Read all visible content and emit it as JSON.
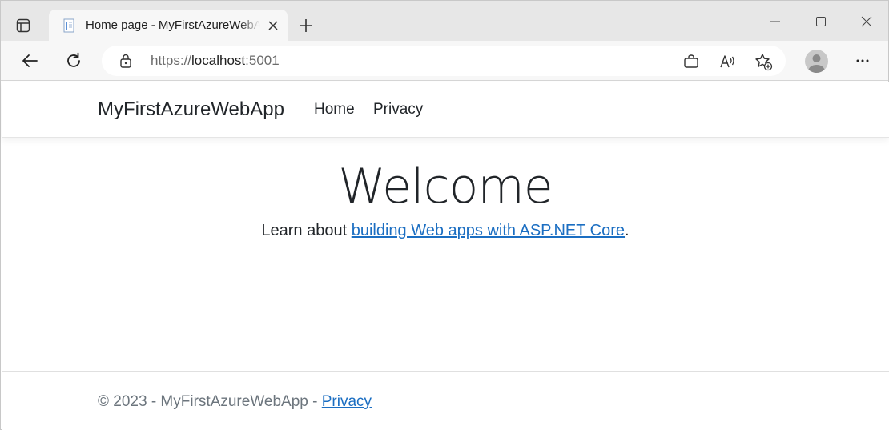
{
  "browser": {
    "tab": {
      "title": "Home page - MyFirstAzureWebApp"
    },
    "address": {
      "scheme": "https://",
      "host": "localhost",
      "port": ":5001"
    }
  },
  "site": {
    "brand": "MyFirstAzureWebApp",
    "nav": {
      "home": "Home",
      "privacy": "Privacy"
    },
    "main": {
      "heading": "Welcome",
      "learn_prefix": "Learn about ",
      "learn_link": "building Web apps with ASP.NET Core",
      "learn_suffix": "."
    },
    "footer": {
      "copyright": "© 2023 - MyFirstAzureWebApp - ",
      "privacy_link": "Privacy"
    }
  },
  "colors": {
    "link": "#1b6ec2",
    "tabstrip": "#e7e7e7",
    "toolbar": "#f7f7f7",
    "text": "#212529",
    "muted": "#6c757d"
  }
}
